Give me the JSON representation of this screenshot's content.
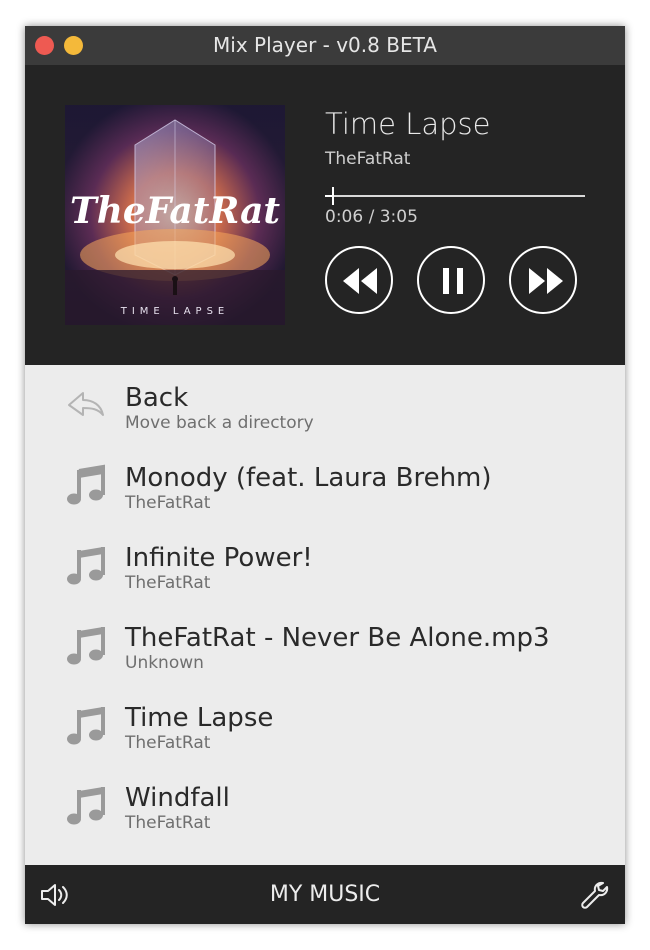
{
  "window": {
    "title": "Mix Player - v0.8 BETA"
  },
  "now_playing": {
    "title": "Time Lapse",
    "artist": "TheFatRat",
    "time_display": "0:06 / 3:05",
    "progress_fraction": 0.032,
    "album_art": {
      "brand_text": "TheFatRat",
      "album_text": "TIME LAPSE"
    }
  },
  "controls": {
    "rewind_icon": "rewind-icon",
    "play_pause_icon": "pause-icon",
    "forward_icon": "fast-forward-icon"
  },
  "browser": {
    "items": [
      {
        "title": "Back",
        "subtitle": "Move back a directory",
        "icon": "back-arrow-icon"
      },
      {
        "title": "Monody (feat. Laura Brehm)",
        "subtitle": "TheFatRat",
        "icon": "music-note-icon"
      },
      {
        "title": "Infinite Power!",
        "subtitle": "TheFatRat",
        "icon": "music-note-icon"
      },
      {
        "title": "TheFatRat - Never Be Alone.mp3",
        "subtitle": "Unknown",
        "icon": "music-note-icon"
      },
      {
        "title": "Time Lapse",
        "subtitle": "TheFatRat",
        "icon": "music-note-icon"
      },
      {
        "title": "Windfall",
        "subtitle": "TheFatRat",
        "icon": "music-note-icon"
      }
    ]
  },
  "bottom_bar": {
    "title": "MY MUSIC",
    "left_icon": "volume-icon",
    "right_icon": "wrench-icon"
  },
  "colors": {
    "titlebar": "#3b3b3b",
    "player_bg": "#242424",
    "list_bg": "#ececec",
    "close_dot": "#ee5a52",
    "minimize_dot": "#f4b93a"
  }
}
